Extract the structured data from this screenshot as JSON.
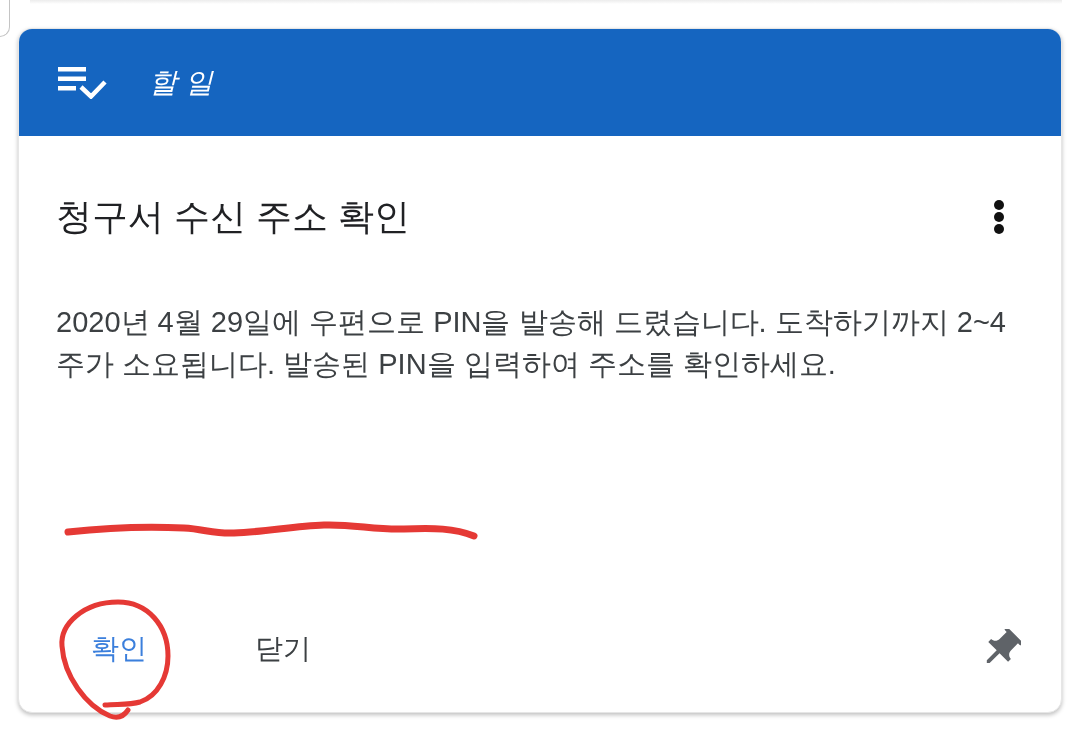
{
  "header": {
    "title": "할 일"
  },
  "task": {
    "title": "청구서 수신 주소 확인",
    "message": "2020년 4월 29일에 우편으로 PIN을 발송해 드렸습니다. 도착하기까지 2~4 주가 소요됩니다. 발송된 PIN을 입력하여 주소를 확인하세요."
  },
  "actions": [
    {
      "label": "확인",
      "kind": "primary"
    },
    {
      "label": "닫기",
      "kind": "secondary"
    }
  ]
}
